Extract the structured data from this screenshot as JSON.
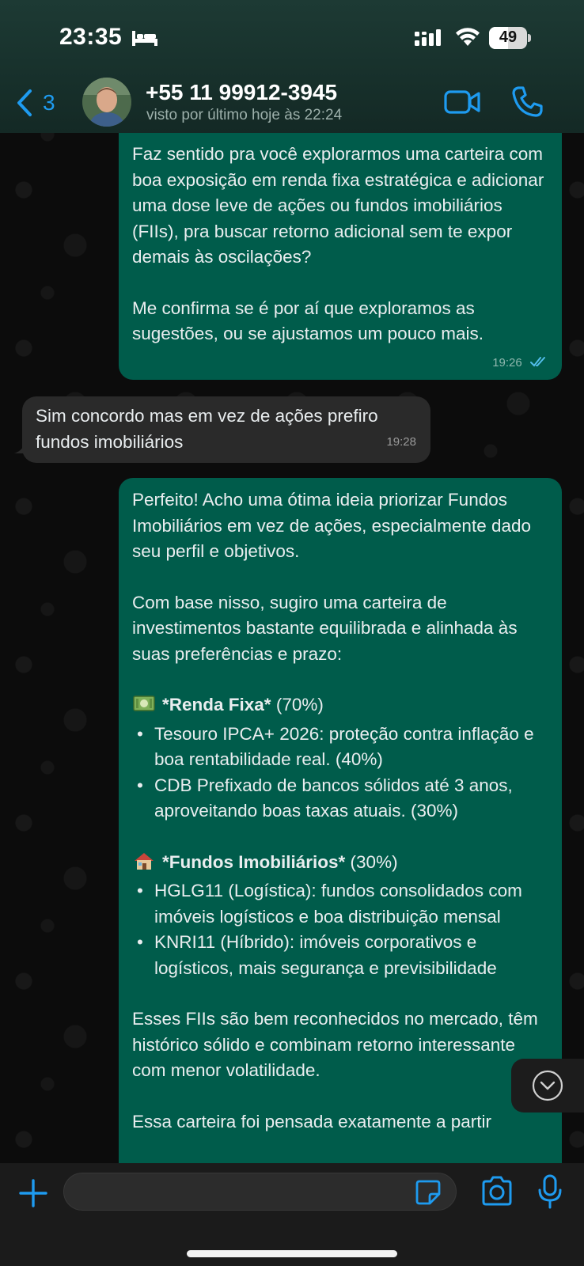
{
  "status_bar": {
    "time": "23:35",
    "battery": "49",
    "battery_level": 0.49
  },
  "header": {
    "back_count": "3",
    "contact_name": "+55 11 99912-3945",
    "last_seen": "visto por último hoje às 22:24"
  },
  "messages": [
    {
      "direction": "out",
      "paragraphs": [
        "Faz sentido pra você explorarmos uma carteira com boa exposição em renda fixa estratégica e adicionar uma dose leve de ações ou fundos imobiliários (FIIs), pra buscar retorno adicional sem te expor demais às oscilações?",
        "Me confirma se é por aí que exploramos as sugestões, ou se ajustamos um pouco mais."
      ],
      "time": "19:26",
      "read": true
    },
    {
      "direction": "in",
      "text": "Sim concordo mas em vez de ações prefiro fundos imobiliários",
      "time": "19:28"
    },
    {
      "direction": "out",
      "intro": "Perfeito! Acho uma ótima ideia priorizar Fundos Imobiliários em vez de ações, especialmente dado seu perfil e objetivos.",
      "basis": "Com base nisso, sugiro uma carteira de investimentos bastante equilibrada e alinhada às suas preferências e prazo:",
      "section1": {
        "emoji": "money-bag-icon",
        "title": "*Renda Fixa*",
        "weight": "(70%)",
        "items": [
          "Tesouro IPCA+ 2026: proteção contra inflação e boa rentabilidade real. (40%)",
          "CDB Prefixado de bancos sólidos até 3 anos, aproveitando boas taxas atuais. (30%)"
        ]
      },
      "section2": {
        "emoji": "house-icon",
        "title": "*Fundos Imobiliários*",
        "weight": "(30%)",
        "items": [
          "HGLG11 (Logística): fundos consolidados com imóveis logísticos e boa distribuição mensal",
          "KNRI11 (Híbrido): imóveis corporativos e logísticos, mais segurança e previsibilidade"
        ]
      },
      "closing": "Esses FIIs são bem reconhecidos no mercado, têm histórico sólido e combinam retorno interessante com menor volatilidade.",
      "cut_off": "Essa carteira foi pensada exatamente a partir"
    }
  ],
  "composer": {
    "placeholder": "",
    "value": ""
  },
  "colors": {
    "outgoing_bubble": "#005c4b",
    "incoming_bubble": "#2a2a2a",
    "accent": "#1e9bf0",
    "header_bg": "#17302b"
  }
}
